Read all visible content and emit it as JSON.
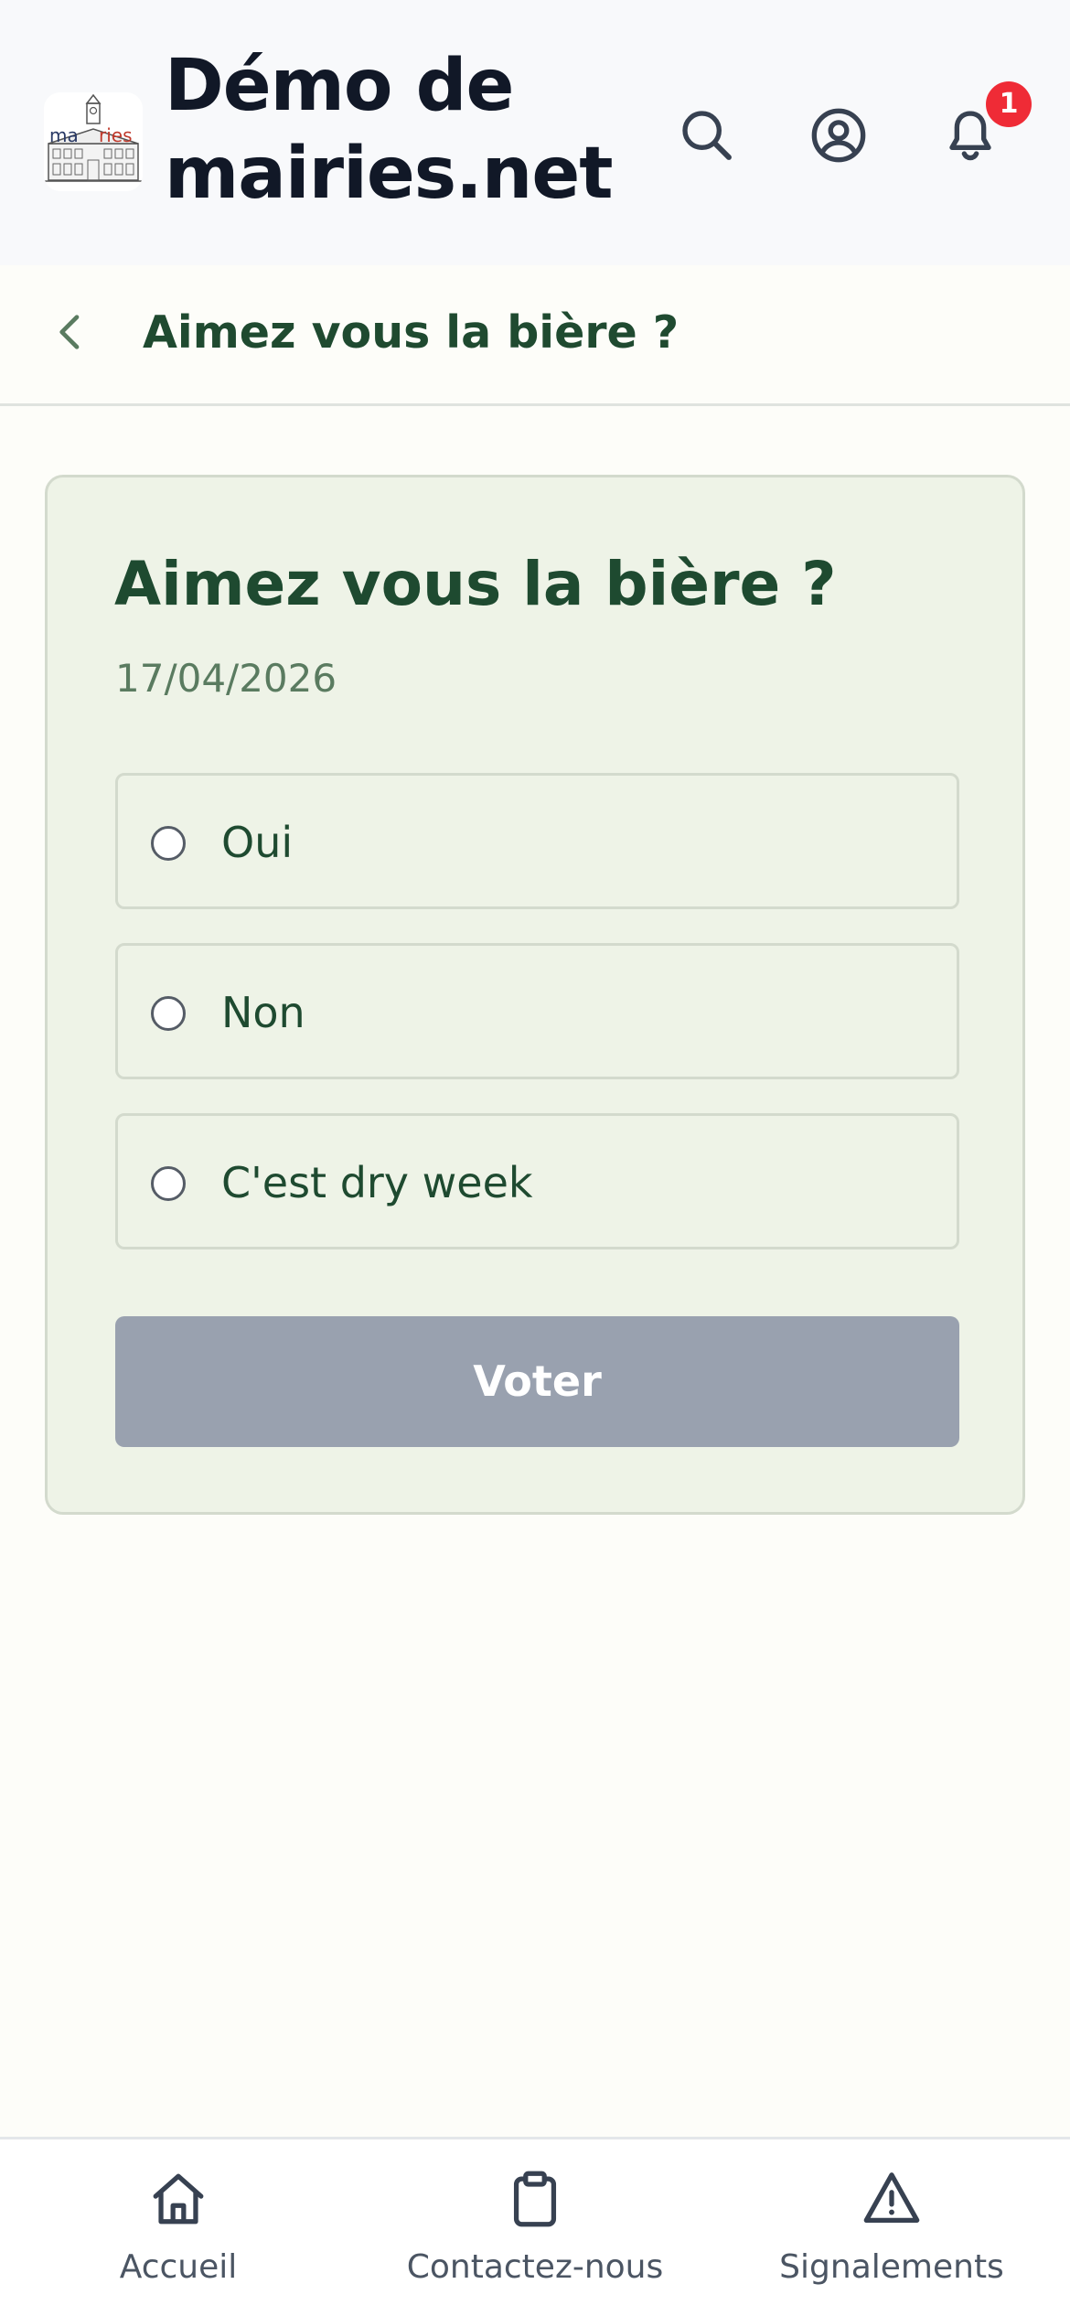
{
  "header": {
    "logo_text_left": "ma",
    "logo_text_right": "ries",
    "title": "Démo de mairies.net",
    "notification_count": "1"
  },
  "subheader": {
    "title": "Aimez vous la bière ?"
  },
  "poll": {
    "title": "Aimez vous la bière ?",
    "date": "17/04/2026",
    "options": [
      {
        "label": "Oui",
        "selected": false
      },
      {
        "label": "Non",
        "selected": false
      },
      {
        "label": "C'est dry week",
        "selected": false
      }
    ],
    "vote_label": "Voter"
  },
  "bottom_nav": {
    "items": [
      {
        "label": "Accueil",
        "icon": "home-icon"
      },
      {
        "label": "Contactez-nous",
        "icon": "clipboard-icon"
      },
      {
        "label": "Signalements",
        "icon": "warning-icon"
      }
    ]
  },
  "colors": {
    "accent_green": "#1e4a30",
    "card_background": "#eef3e7",
    "vote_button_disabled": "#99a1af",
    "badge_red": "#ef2b36"
  }
}
